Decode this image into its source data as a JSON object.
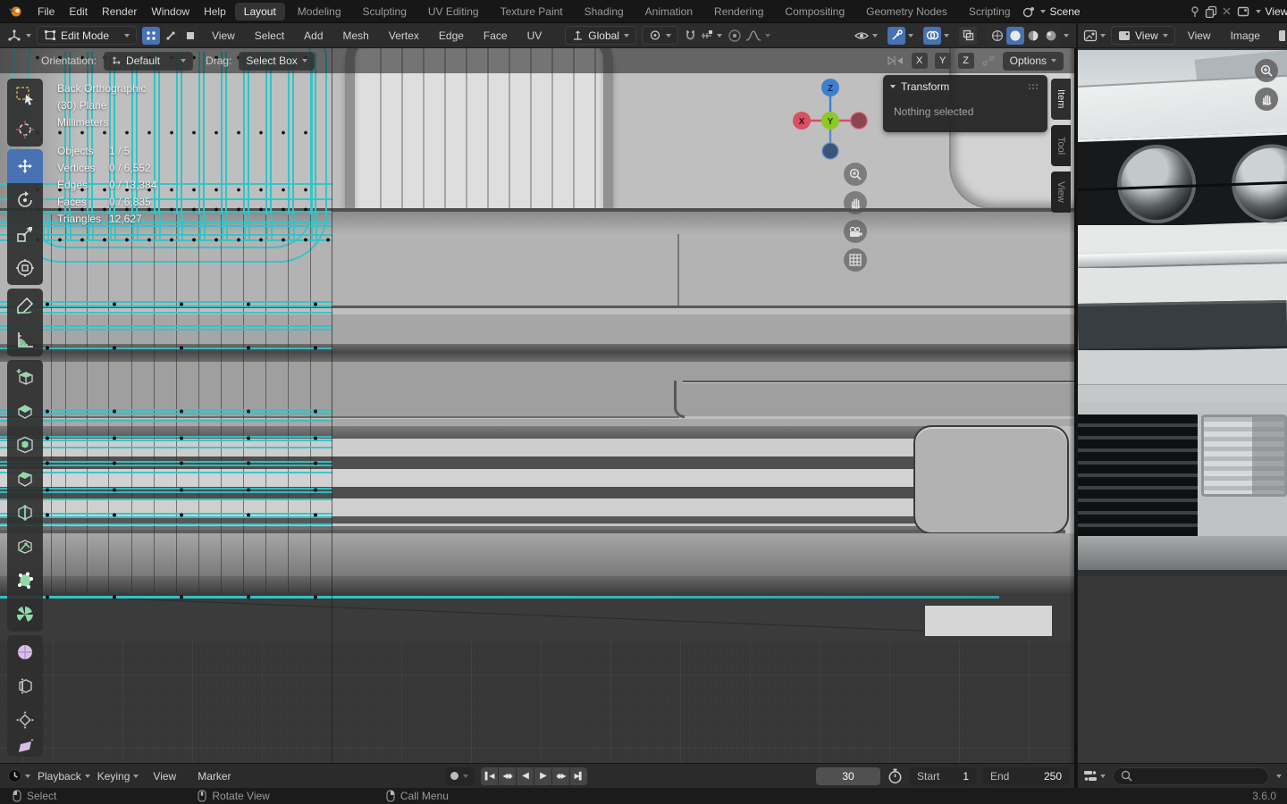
{
  "topbar": {
    "menus": [
      "File",
      "Edit",
      "Render",
      "Window",
      "Help"
    ],
    "tabs": [
      "Layout",
      "Modeling",
      "Sculpting",
      "UV Editing",
      "Texture Paint",
      "Shading",
      "Animation",
      "Rendering",
      "Compositing",
      "Geometry Nodes",
      "Scripting"
    ],
    "active_tab": "Layout",
    "scene": {
      "label": "Scene"
    },
    "view_layer": {
      "label": "ViewLayer"
    }
  },
  "viewport_header": {
    "mode": "Edit Mode",
    "menus": [
      "View",
      "Select",
      "Add",
      "Mesh",
      "Vertex",
      "Edge",
      "Face",
      "UV"
    ],
    "orientation": "Global"
  },
  "image_editor": {
    "display_mode": "View",
    "menus": [
      "View",
      "Image"
    ]
  },
  "tool_settings": {
    "orientation_label": "Orientation:",
    "orientation_value": "Default",
    "drag_label": "Drag:",
    "drag_value": "Select Box",
    "mirror": {
      "x": "X",
      "y": "Y",
      "z": "Z"
    },
    "options": "Options"
  },
  "viewport": {
    "view_name": "Back Orthographic",
    "object_name": "(30) Plane",
    "units": "Millimeters",
    "stats": [
      [
        "Objects",
        "1 / 5"
      ],
      [
        "Vertices",
        "0 / 6,552"
      ],
      [
        "Edges",
        "0 / 13,384"
      ],
      [
        "Faces",
        "0 / 6,835"
      ],
      [
        "Triangles",
        "12,627"
      ]
    ],
    "gizmo": {
      "x": "X",
      "y": "Y",
      "z": "Z"
    },
    "n_panel": {
      "title": "Transform",
      "message": "Nothing selected"
    },
    "sidebar_tabs": [
      "Item",
      "Tool",
      "View"
    ]
  },
  "timeline": {
    "menus": [
      "Playback",
      "Keying",
      "View",
      "Marker"
    ],
    "transport": [
      "▌◀",
      "◀◆",
      "◀",
      "▶",
      "◆▶",
      "▶▌"
    ],
    "current_frame": "30",
    "start_label": "Start",
    "start_value": "1",
    "end_label": "End",
    "end_value": "250"
  },
  "status_bar": {
    "left_mouse": "Select",
    "middle_mouse": "Rotate View",
    "right_mouse": "Call Menu",
    "version": "3.6.0"
  },
  "colors": {
    "accent_blue": "#4772b3",
    "edge_cyan": "#2fc5c9",
    "axis_x_red": "#d94f63",
    "axis_y_green": "#8fc826",
    "axis_z_blue": "#3f7fd0"
  }
}
